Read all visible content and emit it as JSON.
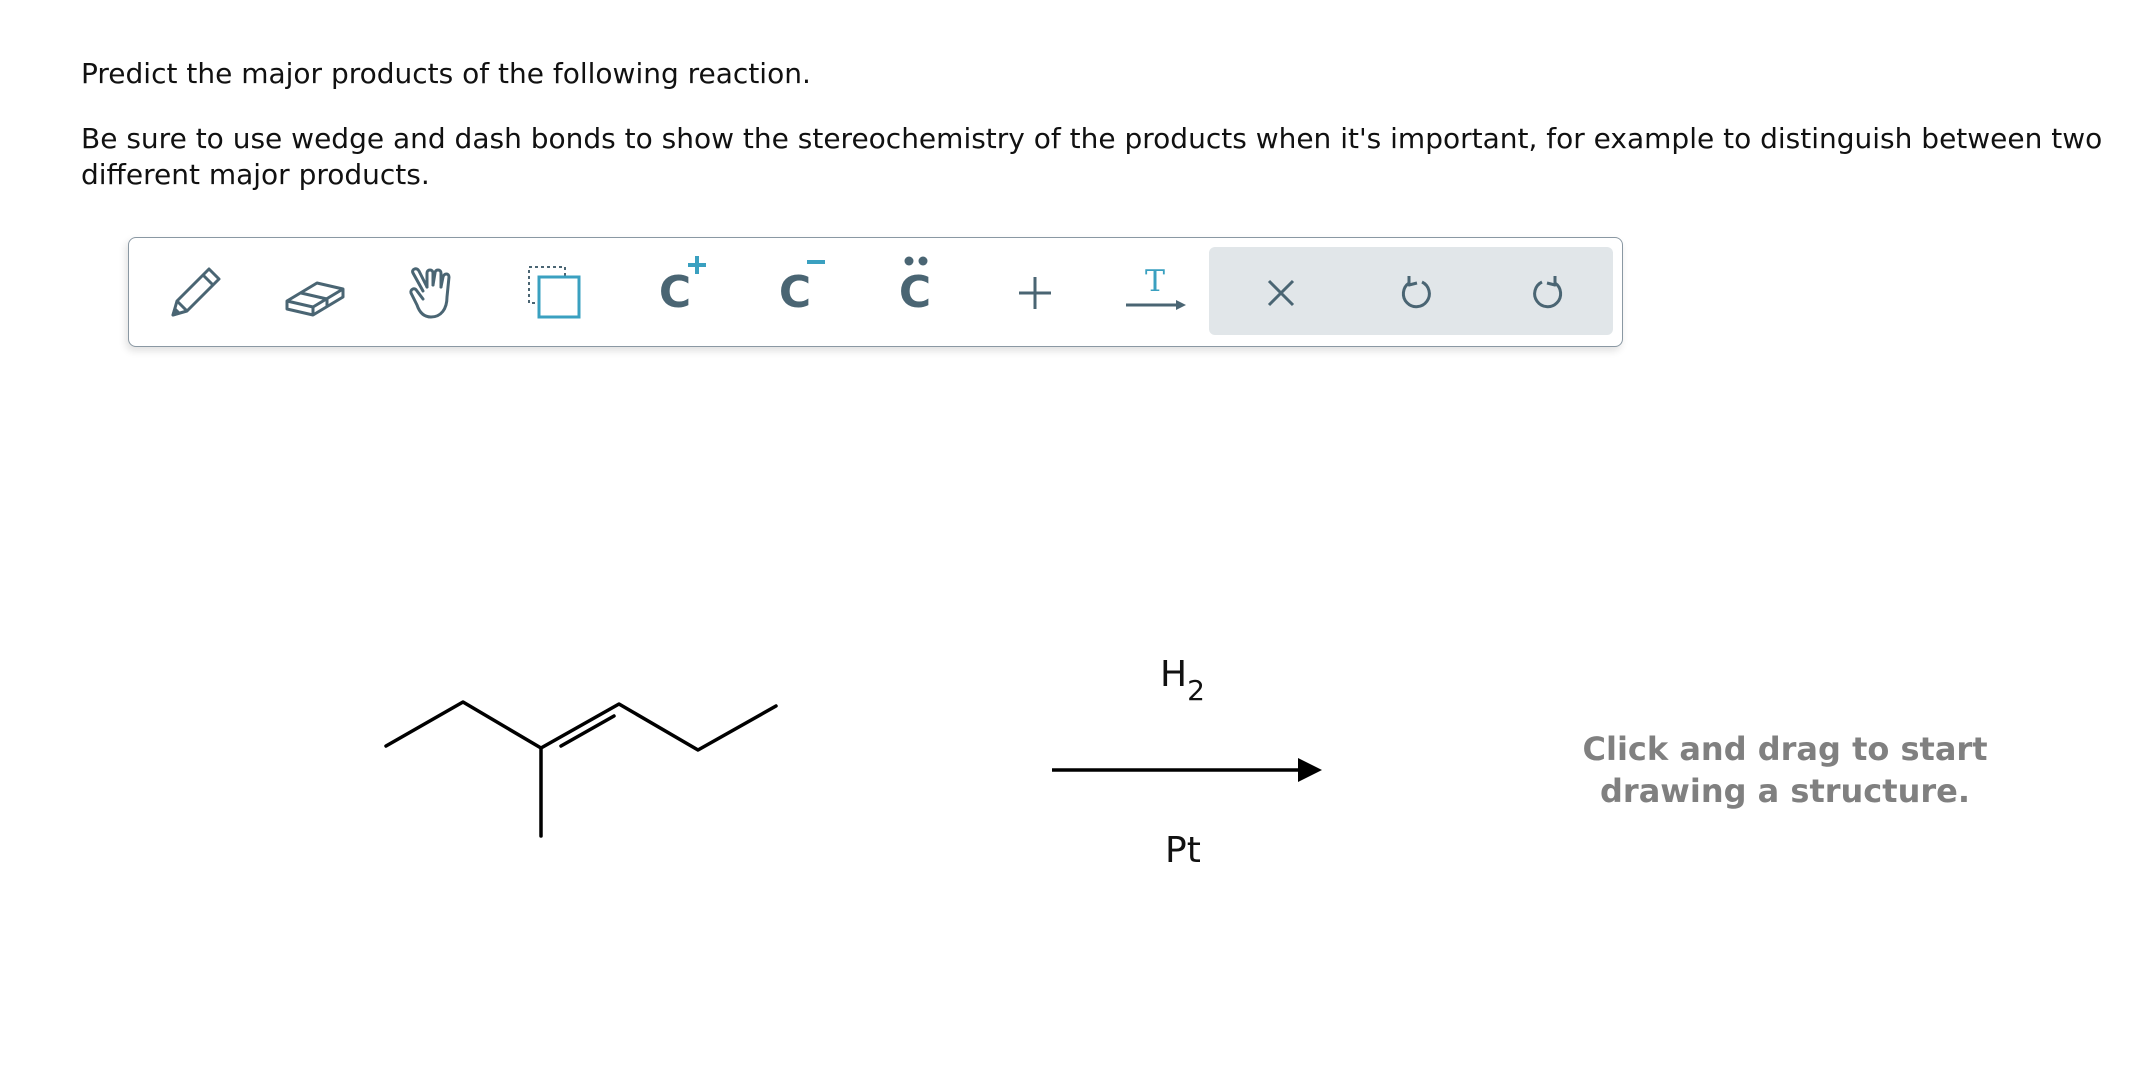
{
  "question": {
    "line1": "Predict the major products of the following reaction.",
    "line2": "Be sure to use wedge and dash bonds to show the stereochemistry of the products when it's important, for example to distinguish between two different major products."
  },
  "toolbar": {
    "tools": [
      {
        "name": "pencil-icon",
        "label": "draw"
      },
      {
        "name": "eraser-icon",
        "label": "erase"
      },
      {
        "name": "hand-icon",
        "label": "move"
      },
      {
        "name": "select-icon",
        "label": "select"
      },
      {
        "name": "carbocation-icon",
        "label": "C+"
      },
      {
        "name": "carbanion-icon",
        "label": "C-"
      },
      {
        "name": "lone-pair-icon",
        "label": "C:"
      },
      {
        "name": "plus-icon",
        "label": "+"
      },
      {
        "name": "reaction-arrow-icon",
        "label": "T"
      }
    ],
    "actions": [
      {
        "name": "clear-icon"
      },
      {
        "name": "undo-icon"
      },
      {
        "name": "redo-icon"
      }
    ],
    "cation_glyph": "C",
    "anion_glyph": "C",
    "lonepair_glyph": "C",
    "arrow_text_glyph": "T"
  },
  "reaction": {
    "reagent_above": "H",
    "reagent_above_subscript": "2",
    "reagent_below": "Pt"
  },
  "canvas": {
    "prompt": "Click and drag to start drawing a structure."
  },
  "colors": {
    "icon": "#4a6573",
    "accent": "#3aa0c0",
    "action_bg": "#e1e6e9",
    "prompt": "#808080"
  }
}
